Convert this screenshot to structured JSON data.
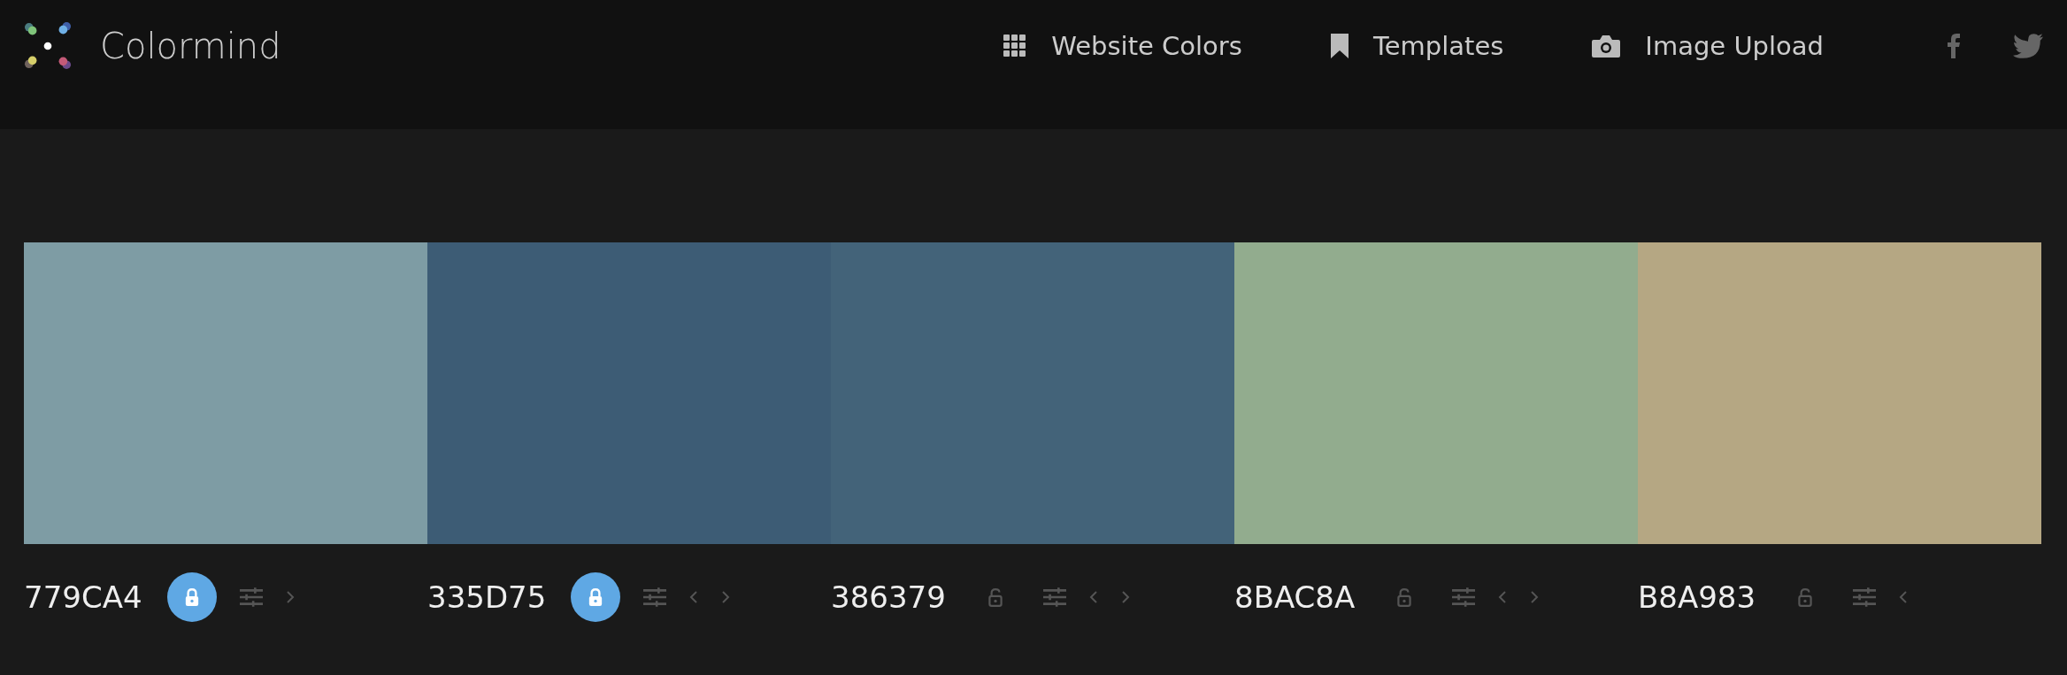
{
  "brand": {
    "name": "Colormind"
  },
  "nav": [
    {
      "kind": "grid",
      "label": "Website Colors"
    },
    {
      "kind": "bookmark",
      "label": "Templates"
    },
    {
      "kind": "camera",
      "label": "Image Upload"
    }
  ],
  "social": [
    {
      "kind": "facebook"
    },
    {
      "kind": "twitter"
    }
  ],
  "palette": [
    {
      "hex": "779CA4",
      "color": "#7e9ca4",
      "locked": true,
      "move_left": false,
      "move_right": true
    },
    {
      "hex": "335D75",
      "color": "#3d5c75",
      "locked": true,
      "move_left": true,
      "move_right": true
    },
    {
      "hex": "386379",
      "color": "#436379",
      "locked": false,
      "move_left": true,
      "move_right": true
    },
    {
      "hex": "8BAC8A",
      "color": "#92ac8e",
      "locked": false,
      "move_left": true,
      "move_right": true
    },
    {
      "hex": "B8A983",
      "color": "#b5a783",
      "locked": false,
      "move_left": true,
      "move_right": false
    }
  ]
}
